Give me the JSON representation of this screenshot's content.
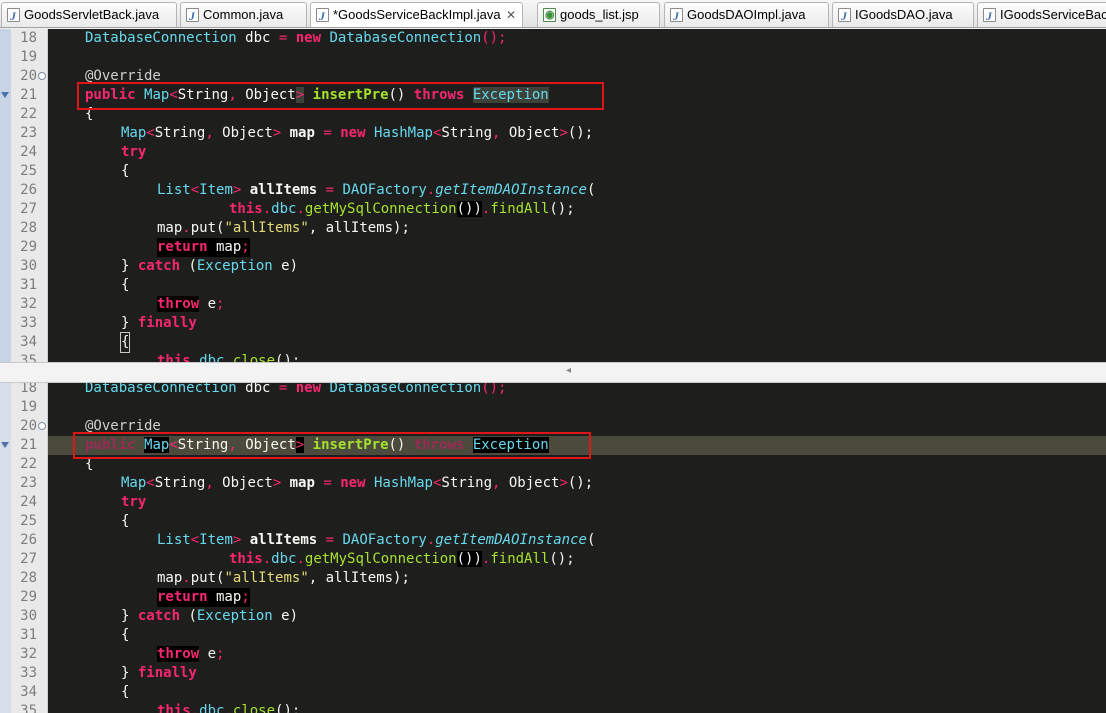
{
  "tabs": [
    {
      "label": "GoodsServletBack.java",
      "icon": "java-file-icon",
      "active": false
    },
    {
      "label": "Common.java",
      "icon": "java-file-icon",
      "active": false
    },
    {
      "label": "*GoodsServiceBackImpl.java",
      "icon": "java-file-icon",
      "active": true,
      "close": "✕"
    },
    {
      "label": "goods_list.jsp",
      "icon": "jsp-file-icon",
      "active": false
    },
    {
      "label": "GoodsDAOImpl.java",
      "icon": "java-file-icon",
      "active": false
    },
    {
      "label": "IGoodsDAO.java",
      "icon": "java-file-icon",
      "active": false
    },
    {
      "label": "IGoodsServiceBac",
      "icon": "java-file-icon",
      "active": false
    }
  ],
  "line_numbers": [
    "18",
    "19",
    "20",
    "21",
    "22",
    "23",
    "24",
    "25",
    "26",
    "27",
    "28",
    "29",
    "30",
    "31",
    "32",
    "33",
    "34",
    "35"
  ],
  "code": {
    "l18": {
      "t1": "DatabaseConnection",
      "t2": " dbc ",
      "t3": "=",
      "t4": " ",
      "t5": "new",
      "t6": " ",
      "t7": "DatabaseConnection",
      "t8": "();"
    },
    "l20": {
      "t1": "@Override"
    },
    "l21": {
      "t1": "public",
      "t2": " ",
      "t3": "Map",
      "t4": "<",
      "t5": "String",
      "t6": ", ",
      "t7": "Object",
      "t8": ">",
      "t9": " ",
      "t10": "insertPre",
      "t11": "()",
      "t12": " ",
      "t13": "throws",
      "t14": " ",
      "t15": "Exception"
    },
    "l22": {
      "t1": "{"
    },
    "l23": {
      "t1": "Map",
      "t2": "<",
      "t3": "String",
      "t4": ", ",
      "t5": "Object",
      "t6": ">",
      "t7": " ",
      "t8": "map",
      "t9": " ",
      "t10": "=",
      "t11": " ",
      "t12": "new",
      "t13": " ",
      "t14": "HashMap",
      "t15": "<",
      "t16": "String",
      "t17": ", ",
      "t18": "Object",
      "t19": ">",
      "t20": "();"
    },
    "l24": {
      "t1": "try"
    },
    "l25": {
      "t1": "{"
    },
    "l26": {
      "t1": "List",
      "t2": "<",
      "t3": "Item",
      "t4": ">",
      "t5": " ",
      "t6": "allItems",
      "t7": " ",
      "t8": "=",
      "t9": " ",
      "t10": "DAOFactory",
      "t11": ".",
      "t12": "getItemDAOInstance",
      "t13": "("
    },
    "l27": {
      "t1": "this",
      "t2": ".",
      "t3": "dbc",
      "t4": ".",
      "t5": "getMySqlConnection",
      "t6": "())",
      "t7": ".",
      "t8": "findAll",
      "t9": "();"
    },
    "l28": {
      "t1": "map",
      "t2": ".",
      "t3": "put",
      "t4": "(",
      "t5": "\"allItems\"",
      "t6": ", allItems);"
    },
    "l29": {
      "t1": "return",
      "t2": " map",
      "t3": ";"
    },
    "l30": {
      "t1": "} ",
      "t2": "catch",
      "t3": " (",
      "t4": "Exception",
      "t5": " e)"
    },
    "l31": {
      "t1": "{"
    },
    "l32": {
      "t1": "throw",
      "t2": " e",
      "t3": ";"
    },
    "l33": {
      "t1": "} ",
      "t2": "finally"
    },
    "l34": {
      "t1": "{"
    },
    "l35": {
      "t1": "this",
      "t2": ".",
      "t3": "dbc",
      "t4": ".",
      "t5": "close",
      "t6": "();"
    }
  },
  "colors": {
    "editor_bg": "#1e1f1c",
    "keyword": "#f92672",
    "type": "#66d9ef",
    "method": "#a6e22e",
    "string": "#e6db74",
    "highlight_box": "#e01515",
    "current_line": "#4a4b3c"
  }
}
